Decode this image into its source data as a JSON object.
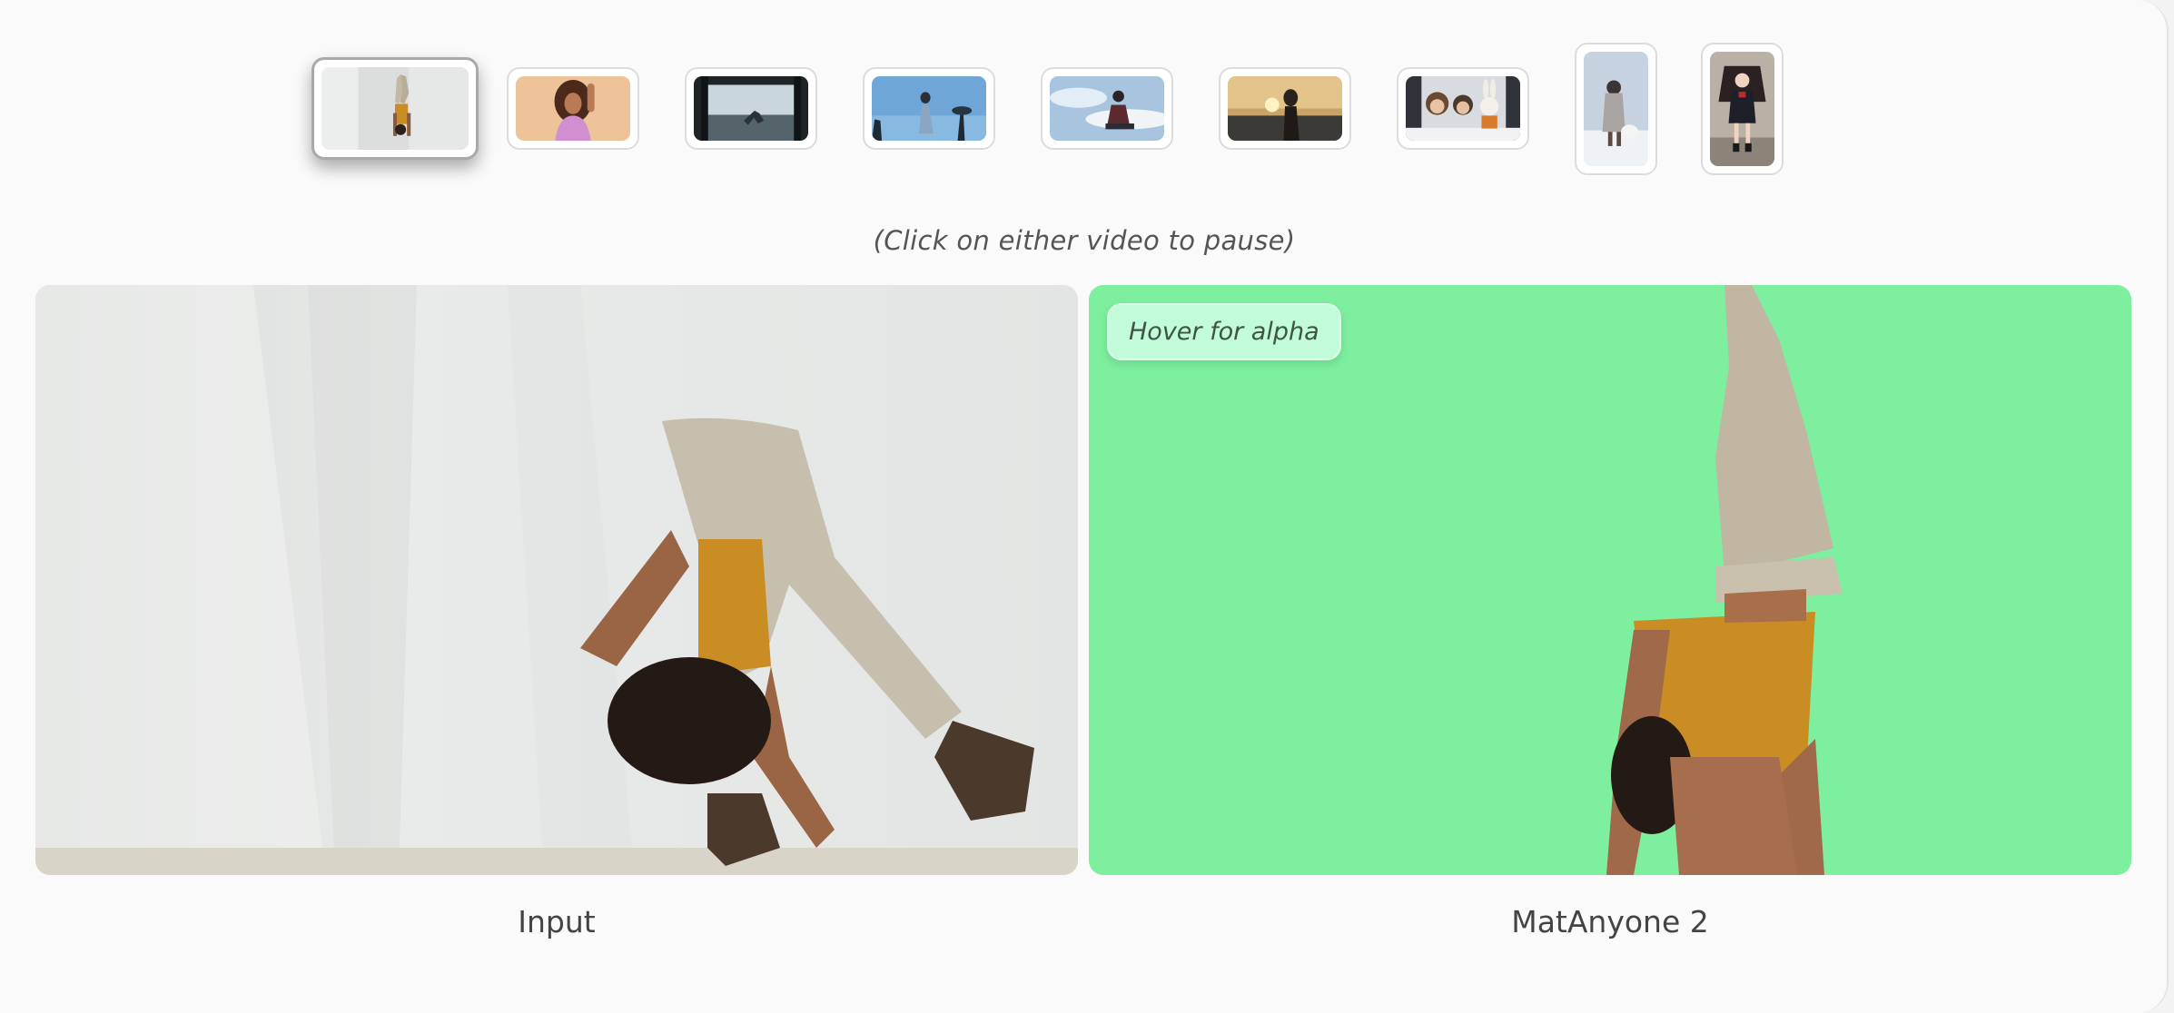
{
  "thumbnails": [
    {
      "name": "handstand-dancer",
      "active": true
    },
    {
      "name": "woman-pink-top",
      "active": false
    },
    {
      "name": "dark-room-figure",
      "active": false
    },
    {
      "name": "girl-blue-sky",
      "active": false
    },
    {
      "name": "man-sitting-sky",
      "active": false
    },
    {
      "name": "woman-sunset-beach",
      "active": false
    },
    {
      "name": "cartoon-characters",
      "active": false
    },
    {
      "name": "anime-girl-snow",
      "active": false
    },
    {
      "name": "anime-girl-school",
      "active": false
    }
  ],
  "hint": "(Click on either video to pause)",
  "panels": {
    "input": {
      "caption": "Input"
    },
    "output": {
      "caption": "MatAnyone 2",
      "badge": "Hover for alpha",
      "background_color": "#7def9f"
    }
  },
  "icons": {
    "play_state": "pause-on-click"
  }
}
